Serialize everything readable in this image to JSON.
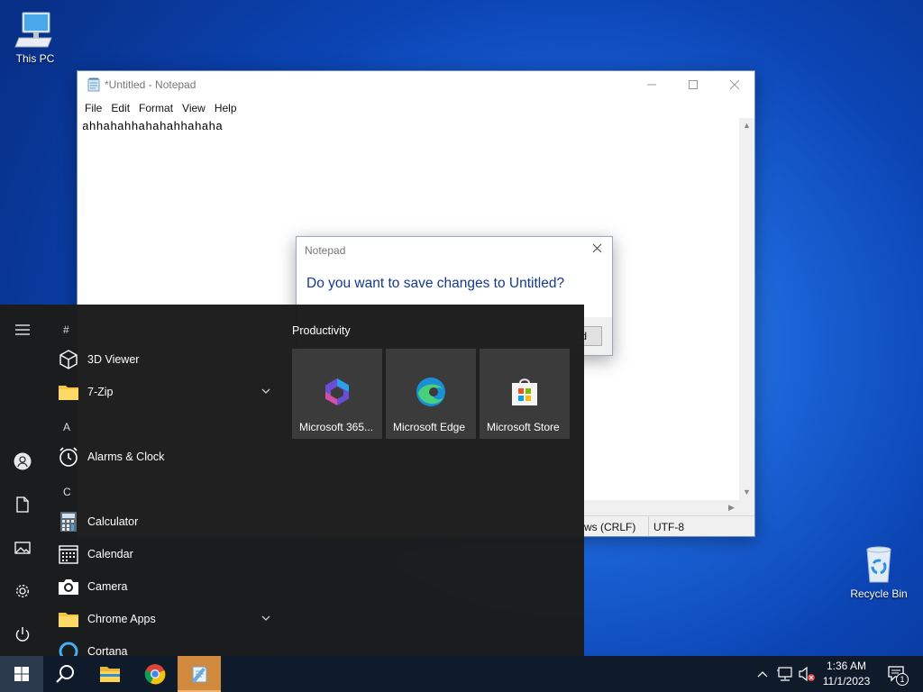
{
  "desktop": {
    "icons": [
      {
        "label": "This PC",
        "icon": "computer-icon"
      },
      {
        "label": "Recycle Bin",
        "icon": "recycle-bin-icon"
      }
    ]
  },
  "notepad": {
    "title": "*Untitled - Notepad",
    "menu": [
      "File",
      "Edit",
      "Format",
      "View",
      "Help"
    ],
    "content": "ahhahahhahahahhahaha",
    "status": {
      "line_ending": "ws (CRLF)",
      "encoding": "UTF-8"
    }
  },
  "dialog": {
    "title": "Notepad",
    "message": "Do you want to save changes to Untitled?",
    "button_partial": "d"
  },
  "start_menu": {
    "sections": [
      {
        "letter": "#",
        "apps": [
          {
            "label": "3D Viewer",
            "icon": "cube-icon"
          },
          {
            "label": "7-Zip",
            "icon": "folder-icon",
            "expandable": true
          }
        ]
      },
      {
        "letter": "A",
        "apps": [
          {
            "label": "Alarms & Clock",
            "icon": "clock-icon"
          }
        ]
      },
      {
        "letter": "C",
        "apps": [
          {
            "label": "Calculator",
            "icon": "calculator-icon"
          },
          {
            "label": "Calendar",
            "icon": "calendar-icon"
          },
          {
            "label": "Camera",
            "icon": "camera-icon"
          },
          {
            "label": "Chrome Apps",
            "icon": "folder-icon",
            "expandable": true
          },
          {
            "label": "Cortana",
            "icon": "cortana-icon"
          }
        ]
      }
    ],
    "tiles_group": "Productivity",
    "tiles": [
      {
        "label": "Microsoft 365...",
        "icon": "microsoft-365-icon"
      },
      {
        "label": "Microsoft Edge",
        "icon": "edge-icon"
      },
      {
        "label": "Microsoft Store",
        "icon": "store-icon"
      }
    ],
    "rail": [
      "menu-icon",
      "user-icon",
      "documents-icon",
      "pictures-icon",
      "settings-icon",
      "power-icon"
    ]
  },
  "taskbar": {
    "buttons": [
      "start-icon",
      "search-icon",
      "file-explorer-icon",
      "chrome-icon",
      "notepad-icon"
    ],
    "active": "notepad-icon",
    "time": "1:36 AM",
    "date": "11/1/2023",
    "notification_count": "1"
  }
}
